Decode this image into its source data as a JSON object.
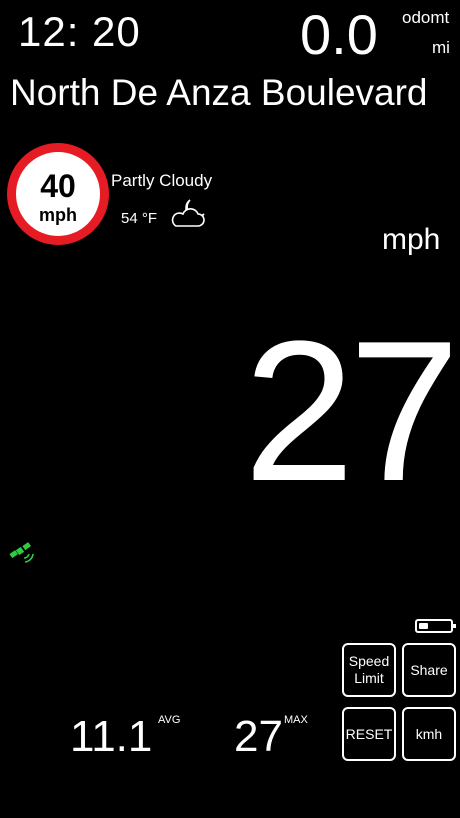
{
  "header": {
    "clock": "12: 20",
    "odometer_value": "0.0",
    "odometer_label": "odomt",
    "odometer_unit": "mi"
  },
  "street": "North De Anza Boulevard",
  "speed_limit": {
    "value": "40",
    "unit": "mph",
    "ring_color": "#e51c23"
  },
  "weather": {
    "description": "Partly Cloudy",
    "temperature": "54 °F",
    "icon": "partly-cloudy-night-icon"
  },
  "speed": {
    "unit": "mph",
    "value": "27"
  },
  "gps": {
    "icon": "satellite-icon",
    "color": "#2ecc40"
  },
  "battery": {
    "icon": "battery-icon",
    "level": 0.3
  },
  "buttons": {
    "speed_limit": "Speed Limit",
    "share": "Share",
    "reset": "RESET",
    "kmh": "kmh"
  },
  "stats": {
    "avg_value": "11.1",
    "avg_label": "AVG",
    "max_value": "27",
    "max_label": "MAX"
  }
}
